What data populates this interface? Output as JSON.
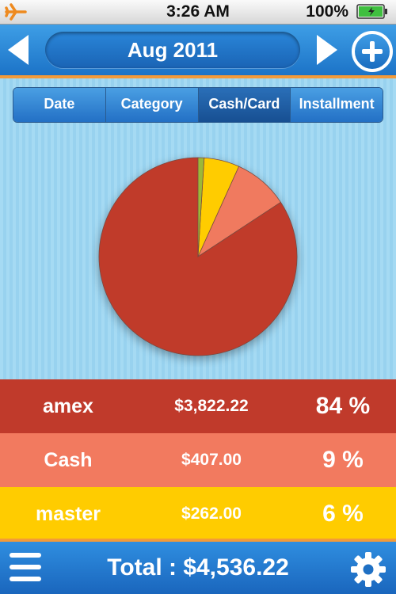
{
  "status_bar": {
    "time": "3:26 AM",
    "battery_text": "100%"
  },
  "nav": {
    "month": "Aug 2011"
  },
  "segments": [
    {
      "label": "Date",
      "selected": false
    },
    {
      "label": "Category",
      "selected": false
    },
    {
      "label": "Cash/Card",
      "selected": true
    },
    {
      "label": "Installment",
      "selected": false
    }
  ],
  "chart_data": {
    "type": "pie",
    "slices": [
      {
        "label": "amex",
        "value": 3822.22,
        "color": "#c03a2b"
      },
      {
        "label": "Cash",
        "value": 407.0,
        "color": "#f07a5e"
      },
      {
        "label": "master",
        "value": 262.0,
        "color": "#ffcc00"
      },
      {
        "label": "",
        "value": 45.0,
        "color": "#9cb839"
      }
    ]
  },
  "rows": [
    {
      "name": "amex",
      "amount": "$3,822.22",
      "percent": "84 %",
      "color": "#c03a2b"
    },
    {
      "name": "Cash",
      "amount": "$407.00",
      "percent": "9 %",
      "color": "#f27a5f"
    },
    {
      "name": "master",
      "amount": "$262.00",
      "percent": "6 %",
      "color": "#ffcc00"
    }
  ],
  "footer": {
    "total": "Total : $4,536.22"
  },
  "colors": {
    "accent": "#f29a3a",
    "bar_blue": "#1c73c7",
    "background": "#a5daf3"
  },
  "icons": {
    "status_left": "airplane-icon",
    "status_right": "battery-icon",
    "nav_prev": "chevron-left-icon",
    "nav_next": "chevron-right-icon",
    "nav_add": "plus-circle-icon",
    "footer_left": "menu-icon",
    "footer_right": "gear-icon"
  }
}
